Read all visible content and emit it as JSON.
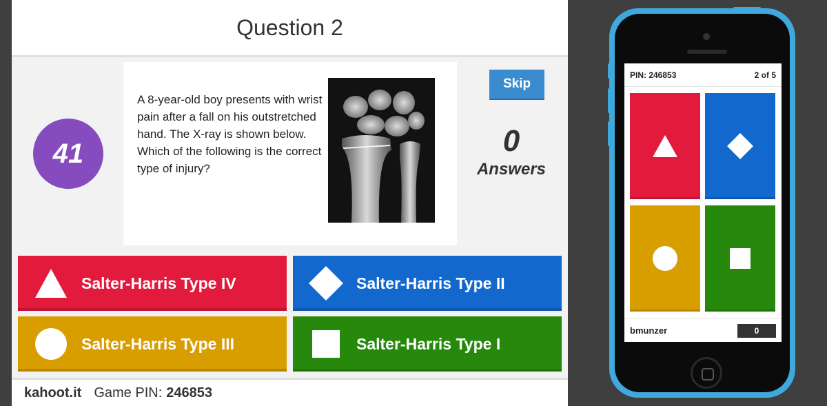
{
  "question": {
    "title": "Question 2",
    "timer": "41",
    "text": "A 8-year-old boy presents with wrist pain after a fall on his outstretched hand.  The X-ray is shown below.  Which of the following is the correct type of injury?",
    "skip_label": "Skip",
    "answers_count": "0",
    "answers_label": "Answers"
  },
  "answers": [
    {
      "label": "Salter-Harris Type IV",
      "shape": "triangle-icon",
      "color": "#e21b3c"
    },
    {
      "label": "Salter-Harris Type II",
      "shape": "diamond-icon",
      "color": "#1368ce"
    },
    {
      "label": "Salter-Harris Type III",
      "shape": "circle-icon",
      "color": "#d89e00"
    },
    {
      "label": "Salter-Harris Type I",
      "shape": "square-icon",
      "color": "#26890c"
    }
  ],
  "footer": {
    "brand": "kahoot.it",
    "pin_label": "Game PIN:",
    "pin": "246853"
  },
  "phone": {
    "pin_text": "PIN: 246853",
    "progress": "2 of 5",
    "username": "bmunzer",
    "score": "0"
  }
}
